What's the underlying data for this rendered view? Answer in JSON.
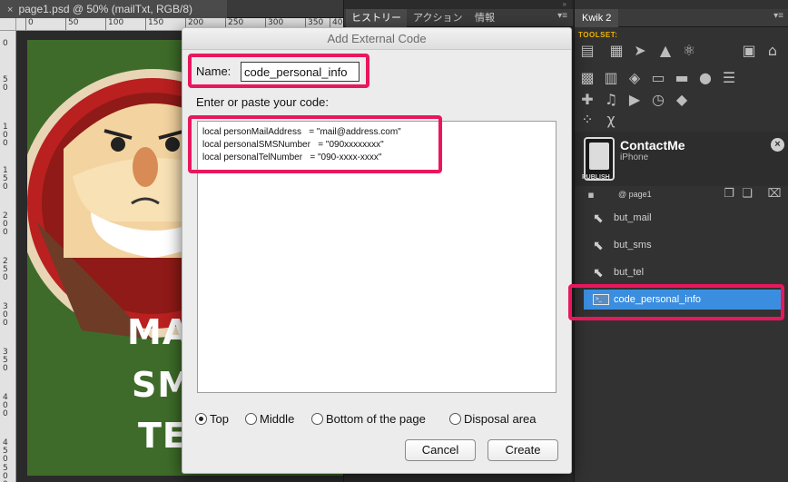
{
  "document": {
    "tab_close": "×",
    "tab_title": "page1.psd @ 50% (mailTxt, RGB/8)",
    "ruler_top": [
      "0",
      "50",
      "100",
      "150",
      "200",
      "250",
      "300",
      "350",
      "400"
    ],
    "ruler_left": [
      "0",
      "50",
      "100",
      "150",
      "200",
      "250",
      "300",
      "350",
      "400",
      "450",
      "500"
    ],
    "art_lines": [
      "MA",
      "SM",
      "TE"
    ]
  },
  "middle_panel": {
    "tabs": [
      "ヒストリー",
      "アクション",
      "情報"
    ],
    "menu": "▾≡"
  },
  "kwik": {
    "tab": "Kwik 2",
    "toolset_label": "TOOLSET:",
    "project_name": "ContactMe",
    "device": "iPhone",
    "publish": "PUBLISH",
    "page": "@ page1",
    "layers": [
      {
        "label": "but_mail",
        "icon": "pointer-cursor-icon",
        "selected": false
      },
      {
        "label": "but_sms",
        "icon": "pointer-cursor-icon",
        "selected": false
      },
      {
        "label": "but_tel",
        "icon": "pointer-cursor-icon",
        "selected": false
      },
      {
        "label": "code_personal_info",
        "icon": "code-icon",
        "selected": true
      }
    ]
  },
  "dialog": {
    "title": "Add External Code",
    "name_label": "Name:",
    "name_value": "code_personal_info",
    "enter_label": "Enter or paste your code:",
    "code_lines": [
      "local personMailAddress   = \"mail@address.com\"",
      "local personalSMSNumber   = \"090xxxxxxxx\"",
      "local personalTelNumber   = \"090-xxxx-xxxx\""
    ],
    "position_options": [
      "Top",
      "Middle",
      "Bottom of the page",
      "Disposal area"
    ],
    "selected_position": "Top",
    "cancel_label": "Cancel",
    "create_label": "Create"
  },
  "colors": {
    "highlight": "#e8175d",
    "selection": "#3b8edf",
    "toolset_accent": "#f2b600",
    "art_background": "#3e6b2a"
  }
}
